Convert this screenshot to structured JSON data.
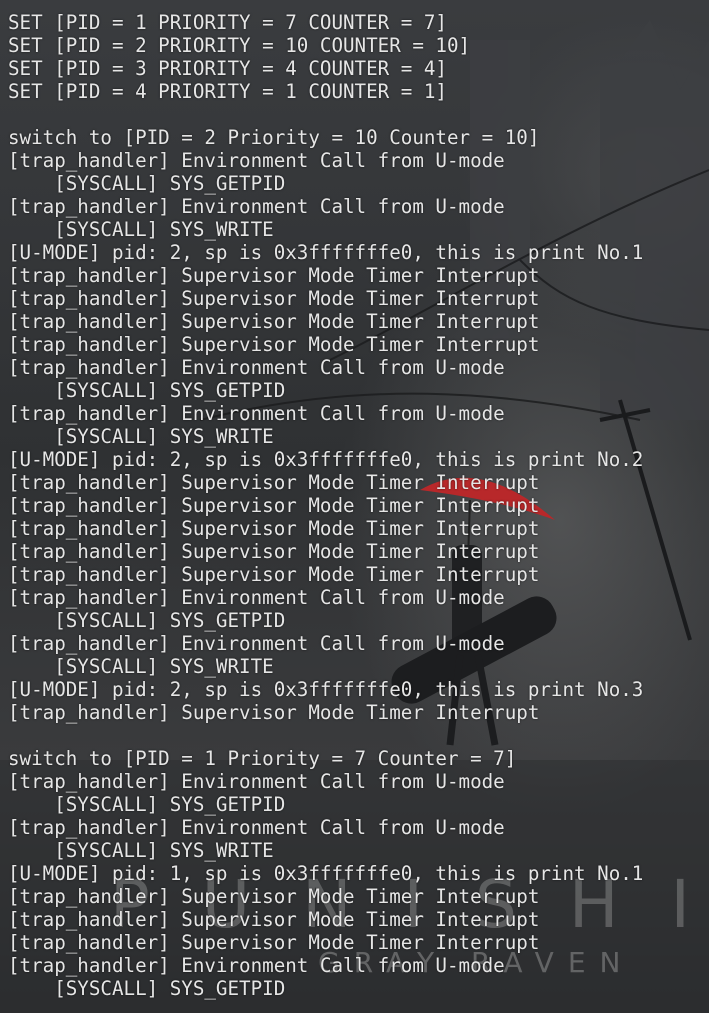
{
  "terminal": {
    "lines": [
      "SET [PID = 1 PRIORITY = 7 COUNTER = 7]",
      "SET [PID = 2 PRIORITY = 10 COUNTER = 10]",
      "SET [PID = 3 PRIORITY = 4 COUNTER = 4]",
      "SET [PID = 4 PRIORITY = 1 COUNTER = 1]",
      "",
      "switch to [PID = 2 Priority = 10 Counter = 10]",
      "[trap_handler] Environment Call from U-mode",
      "    [SYSCALL] SYS_GETPID",
      "[trap_handler] Environment Call from U-mode",
      "    [SYSCALL] SYS_WRITE",
      "[U-MODE] pid: 2, sp is 0x3fffffffe0, this is print No.1",
      "[trap_handler] Supervisor Mode Timer Interrupt",
      "[trap_handler] Supervisor Mode Timer Interrupt",
      "[trap_handler] Supervisor Mode Timer Interrupt",
      "[trap_handler] Supervisor Mode Timer Interrupt",
      "[trap_handler] Environment Call from U-mode",
      "    [SYSCALL] SYS_GETPID",
      "[trap_handler] Environment Call from U-mode",
      "    [SYSCALL] SYS_WRITE",
      "[U-MODE] pid: 2, sp is 0x3fffffffe0, this is print No.2",
      "[trap_handler] Supervisor Mode Timer Interrupt",
      "[trap_handler] Supervisor Mode Timer Interrupt",
      "[trap_handler] Supervisor Mode Timer Interrupt",
      "[trap_handler] Supervisor Mode Timer Interrupt",
      "[trap_handler] Supervisor Mode Timer Interrupt",
      "[trap_handler] Environment Call from U-mode",
      "    [SYSCALL] SYS_GETPID",
      "[trap_handler] Environment Call from U-mode",
      "    [SYSCALL] SYS_WRITE",
      "[U-MODE] pid: 2, sp is 0x3fffffffe0, this is print No.3",
      "[trap_handler] Supervisor Mode Timer Interrupt",
      "",
      "switch to [PID = 1 Priority = 7 Counter = 7]",
      "[trap_handler] Environment Call from U-mode",
      "    [SYSCALL] SYS_GETPID",
      "[trap_handler] Environment Call from U-mode",
      "    [SYSCALL] SYS_WRITE",
      "[U-MODE] pid: 1, sp is 0x3fffffffe0, this is print No.1",
      "[trap_handler] Supervisor Mode Timer Interrupt",
      "[trap_handler] Supervisor Mode Timer Interrupt",
      "[trap_handler] Supervisor Mode Timer Interrupt",
      "[trap_handler] Environment Call from U-mode",
      "    [SYSCALL] SYS_GETPID"
    ]
  },
  "wallpaper": {
    "title": "PUNISHING",
    "subtitle": "GRAY RAVEN",
    "umbrella_color": "#b8282a"
  }
}
